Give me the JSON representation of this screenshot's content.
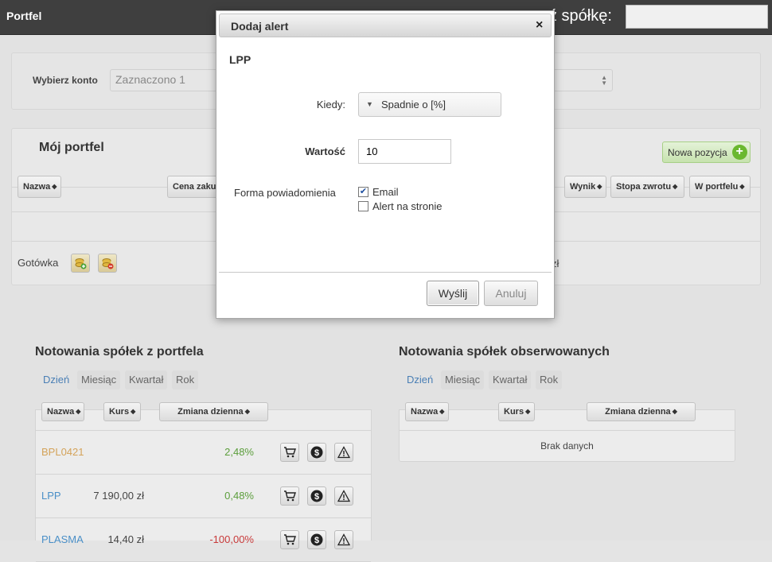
{
  "topbar": {
    "app_title": "Portfel",
    "search_label": "ź spółkę:",
    "search_value": ""
  },
  "account": {
    "label": "Wybierz konto",
    "selected": "Zaznaczono 1"
  },
  "portfolio": {
    "title": "Mój portfel",
    "new_position_label": "Nowa pozycja",
    "columns": [
      "Nazwa",
      "Cena zaku",
      "Wynik",
      "Stopa zwrotu",
      "W portfelu"
    ],
    "cash_label": "Gotówka",
    "cash_currency_fragment": "zł"
  },
  "quotes_portfolio": {
    "title": "Notowania spółek z portfela",
    "tabs": [
      "Dzień",
      "Miesiąc",
      "Kwartał",
      "Rok"
    ],
    "columns": [
      "Nazwa",
      "Kurs",
      "Zmiana dzienna"
    ],
    "rows": [
      {
        "name": "BPL0421",
        "price": "",
        "change": "2,48%",
        "name_color": "#d4a35a",
        "change_color": "#5c9e3c"
      },
      {
        "name": "LPP",
        "price": "7 190,00 zł",
        "change": "0,48%",
        "name_color": "#4a8fc7",
        "change_color": "#5c9e3c"
      },
      {
        "name": "PLASMA",
        "price": "14,40 zł",
        "change": "-100,00%",
        "name_color": "#4a8fc7",
        "change_color": "#c83a3a"
      }
    ]
  },
  "quotes_watched": {
    "title": "Notowania spółek obserwowanych",
    "tabs": [
      "Dzień",
      "Miesiąc",
      "Kwartał",
      "Rok"
    ],
    "columns": [
      "Nazwa",
      "Kurs",
      "Zmiana dzienna"
    ],
    "empty": "Brak danych"
  },
  "modal": {
    "title": "Dodaj alert",
    "close": "×",
    "stock": "LPP",
    "when_label": "Kiedy:",
    "when_value": "Spadnie o [%]",
    "value_label": "Wartość",
    "value": "10",
    "notify_label": "Forma powiadomienia",
    "options": [
      {
        "label": "Email",
        "checked": true
      },
      {
        "label": "Alert na stronie",
        "checked": false
      }
    ],
    "send": "Wyślij",
    "cancel": "Anuluj"
  },
  "colors": {
    "link": "#4a7fb5",
    "positive": "#5c9e3c",
    "negative": "#c83a3a",
    "accent": "#6ab82f"
  }
}
